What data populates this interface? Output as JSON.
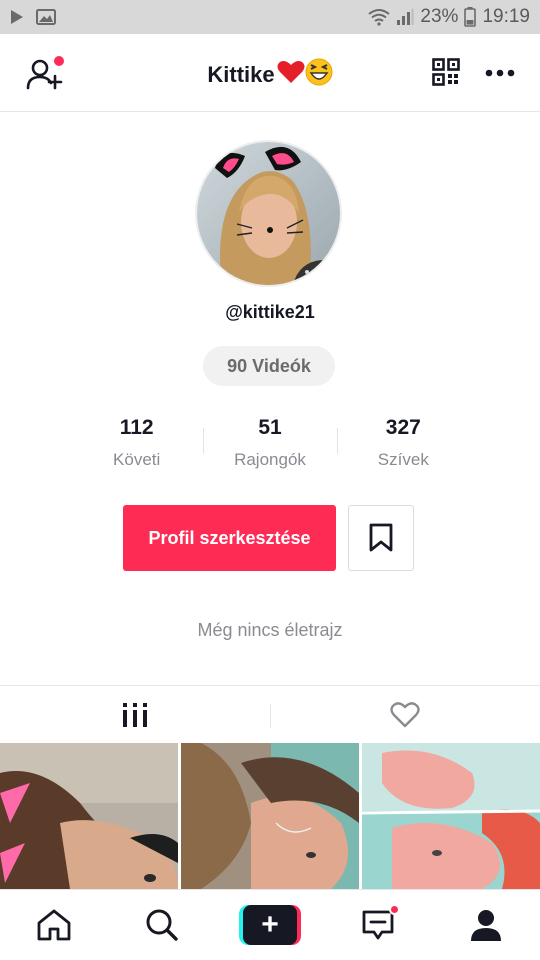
{
  "status_bar": {
    "battery": "23%",
    "time": "19:19"
  },
  "header": {
    "title": "Kittike",
    "title_emojis": [
      "❤️",
      "😆"
    ]
  },
  "profile": {
    "username": "@kittike21",
    "videos_label": "90 Videók",
    "stats": [
      {
        "value": "112",
        "label": "Követi"
      },
      {
        "value": "51",
        "label": "Rajongók"
      },
      {
        "value": "327",
        "label": "Szívek"
      }
    ],
    "edit_button": "Profil szerkesztése",
    "bio_placeholder": "Még nincs életrajz"
  },
  "tabs": [
    {
      "name": "videos-grid",
      "icon": "grid-icon"
    },
    {
      "name": "liked",
      "icon": "heart-icon"
    }
  ],
  "bottom_nav": [
    {
      "name": "home",
      "icon": "home-icon"
    },
    {
      "name": "discover",
      "icon": "search-icon"
    },
    {
      "name": "create",
      "icon": "plus-icon",
      "label": "+"
    },
    {
      "name": "inbox",
      "icon": "inbox-icon"
    },
    {
      "name": "profile",
      "icon": "profile-icon"
    }
  ],
  "colors": {
    "accent": "#fe2c55",
    "text": "#161823",
    "muted": "#8a8b91",
    "cyan": "#25f4ee"
  }
}
